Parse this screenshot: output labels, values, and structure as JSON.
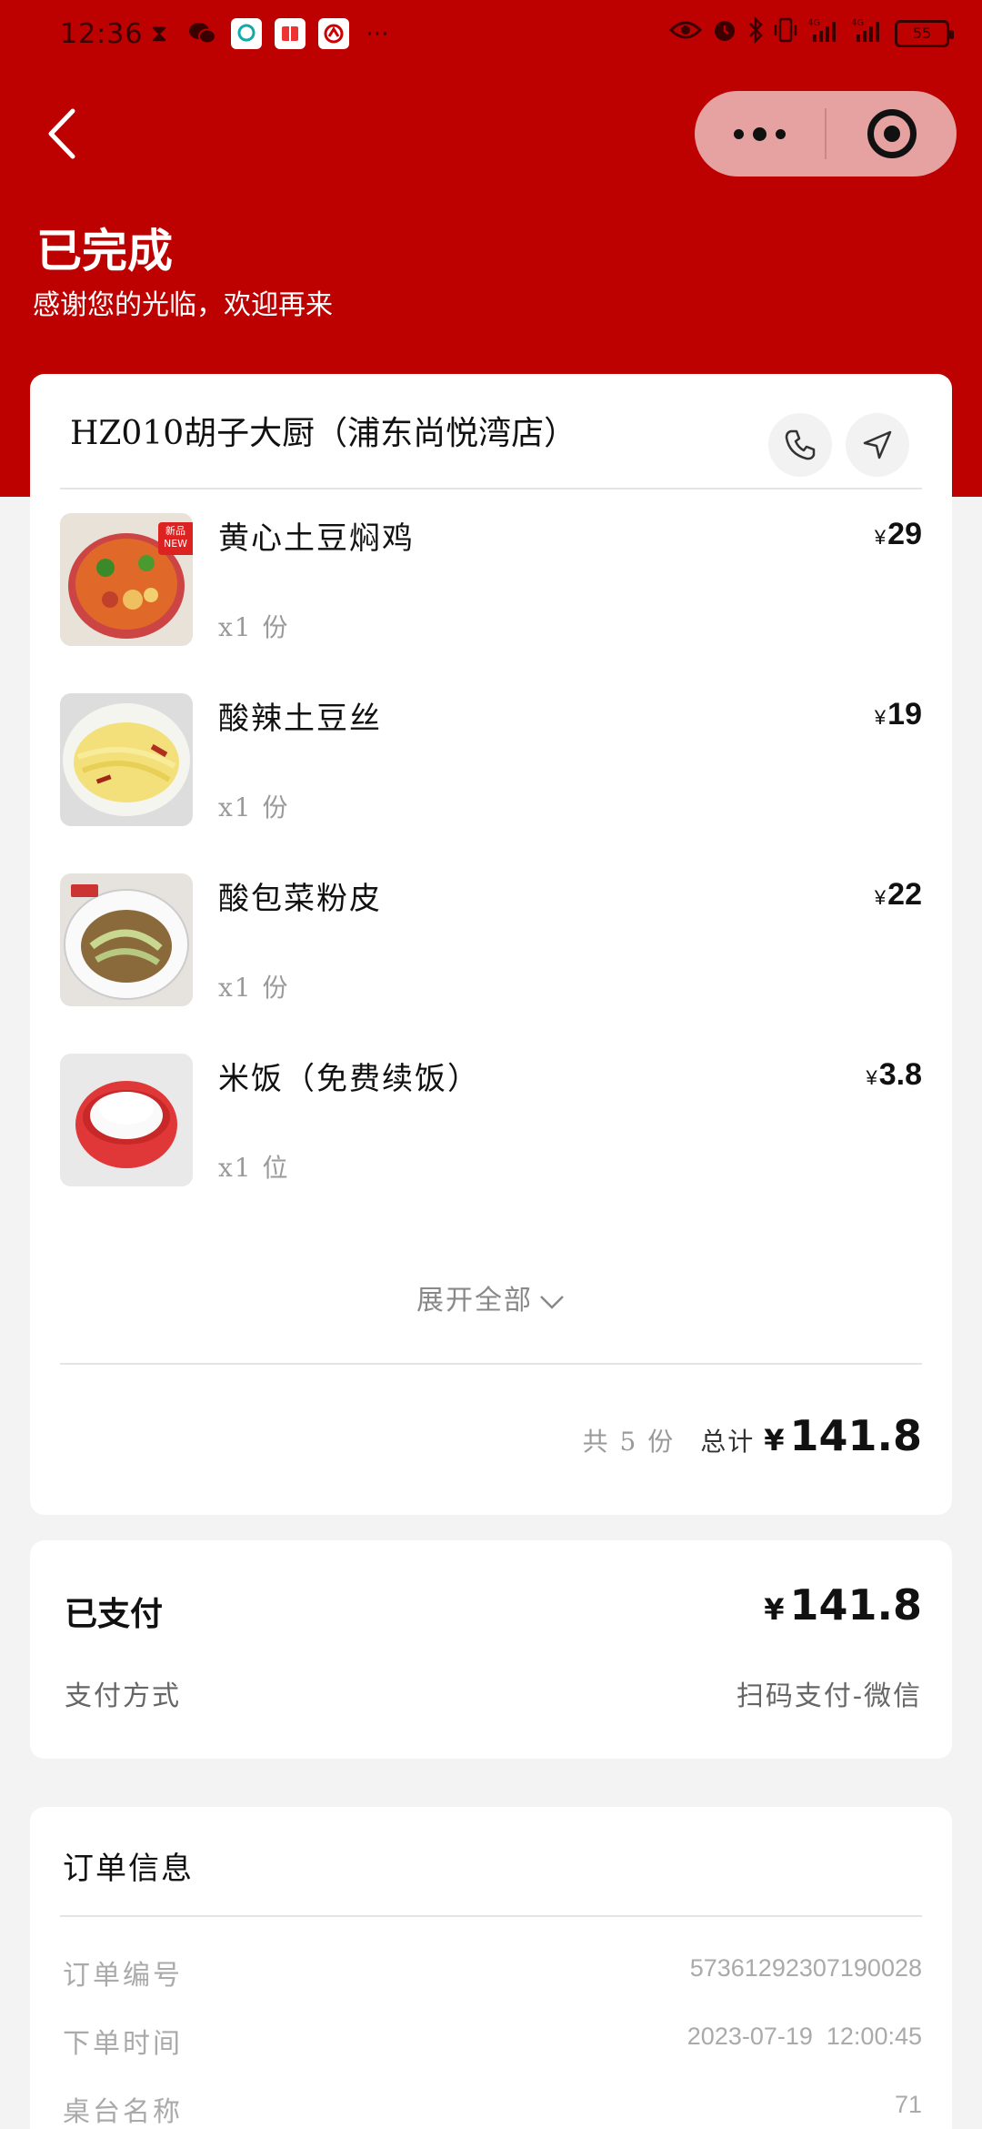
{
  "status_bar": {
    "time": "12:36",
    "battery": "55"
  },
  "header": {
    "status_title": "已完成",
    "status_subtitle": "感谢您的光临，欢迎再来"
  },
  "order": {
    "shop_name": "HZ010胡子大厨（浦东尚悦湾店）",
    "items": [
      {
        "name": "黄心土豆焖鸡",
        "qty": "x1 份",
        "currency": "¥",
        "price": "29",
        "badge": "新品 NEW"
      },
      {
        "name": "酸辣土豆丝",
        "qty": "x1 份",
        "currency": "¥",
        "price": "19"
      },
      {
        "name": "酸包菜粉皮",
        "qty": "x1 份",
        "currency": "¥",
        "price": "22"
      },
      {
        "name": "米饭（免费续饭）",
        "qty": "x1 位",
        "currency": "¥",
        "price": "3.8"
      }
    ],
    "expand_label": "展开全部",
    "total_count": "共 5 份",
    "total_label": "总计",
    "total_currency": "¥",
    "total_amount": "141.8"
  },
  "payment": {
    "label": "已支付",
    "currency": "¥",
    "amount": "141.8",
    "method_label": "支付方式",
    "method_value": "扫码支付-微信"
  },
  "order_info": {
    "title": "订单信息",
    "rows": [
      {
        "label": "订单编号",
        "value": "57361292307190028"
      },
      {
        "label": "下单时间",
        "value": "2023-07-19  12:00:45"
      },
      {
        "label": "桌台名称",
        "value": "71"
      }
    ]
  },
  "colors": {
    "brand_red": "#bd0000",
    "capsule_bg": "#e6a1a1",
    "page_bg": "#f3f3f3"
  }
}
